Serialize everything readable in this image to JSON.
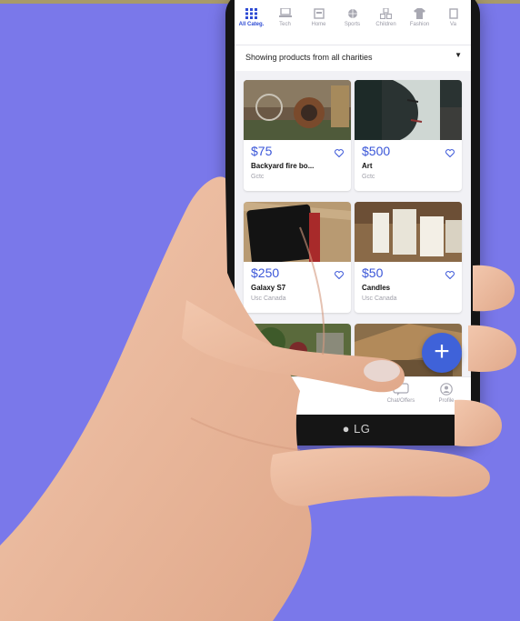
{
  "brand_logo": "LG",
  "categories": [
    {
      "label": "All Categ.",
      "icon": "grid-icon",
      "active": true
    },
    {
      "label": "Tech",
      "icon": "laptop-icon"
    },
    {
      "label": "Home",
      "icon": "home-icon"
    },
    {
      "label": "Sports",
      "icon": "ball-icon"
    },
    {
      "label": "Children",
      "icon": "blocks-icon"
    },
    {
      "label": "Fashion",
      "icon": "shirt-icon"
    },
    {
      "label": "Va",
      "icon": "more-icon"
    }
  ],
  "filter": {
    "label": "Showing products from all charities",
    "caret": "▼"
  },
  "products": [
    {
      "price": "$75",
      "title": "Backyard fire bo...",
      "org": "Gctc"
    },
    {
      "price": "$500",
      "title": "Art",
      "org": "Gctc"
    },
    {
      "price": "$250",
      "title": "Galaxy S7",
      "org": "Usc Canada"
    },
    {
      "price": "$50",
      "title": "Candles",
      "org": "Usc Canada"
    }
  ],
  "fab_label": "+",
  "tabs": [
    {
      "label": "",
      "icon": "home-icon"
    },
    {
      "label": "",
      "icon": "search-icon"
    },
    {
      "label": "",
      "icon": "add-icon"
    },
    {
      "label": "Chat/Offers",
      "icon": "chat-icon"
    },
    {
      "label": "Profile",
      "icon": "user-icon"
    }
  ],
  "colors": {
    "background": "#7a78ea",
    "accent": "#3a56d8",
    "fab": "#3f62d9"
  }
}
